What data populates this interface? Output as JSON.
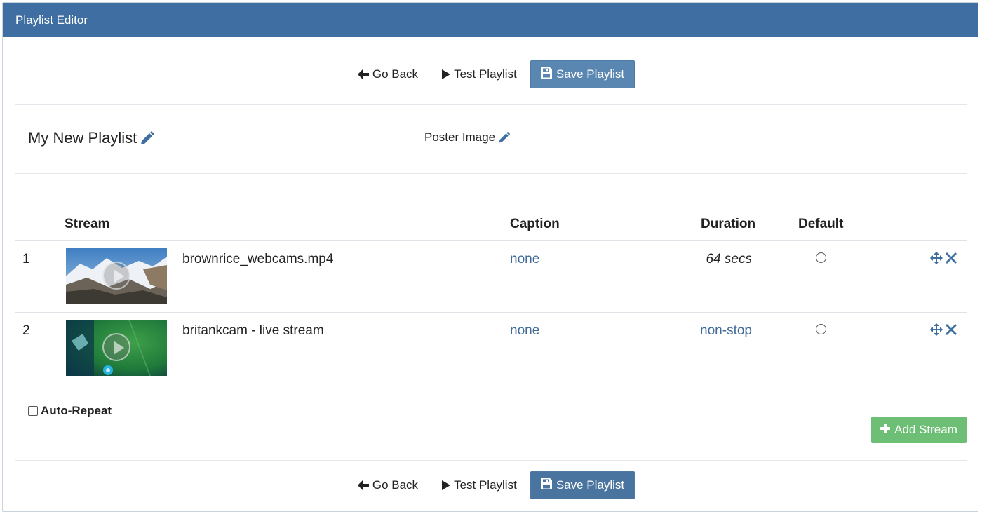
{
  "header": {
    "title": "Playlist Editor"
  },
  "toolbar": {
    "go_back": "Go Back",
    "test_playlist": "Test Playlist",
    "save_playlist": "Save Playlist"
  },
  "playlist": {
    "title": "My New Playlist",
    "poster_label": "Poster Image"
  },
  "table": {
    "headers": {
      "stream": "Stream",
      "caption": "Caption",
      "duration": "Duration",
      "default": "Default"
    },
    "rows": [
      {
        "index": "1",
        "name": "brownrice_webcams.mp4",
        "caption": "none",
        "duration": "64 secs",
        "thumbnail": "mountain-snow-thumbnail",
        "default_selected": false
      },
      {
        "index": "2",
        "name": "britankcam - live stream",
        "caption": "none",
        "duration": "non-stop",
        "thumbnail": "underwater-green-thumbnail",
        "default_selected": false
      }
    ]
  },
  "options": {
    "auto_repeat_label": "Auto-Repeat",
    "auto_repeat_checked": false
  },
  "actions": {
    "add_stream": "Add Stream"
  },
  "icons": {
    "back": "arrow-left-icon",
    "play": "play-icon",
    "save": "floppy-disk-icon",
    "edit": "pencil-icon",
    "move": "move-arrows-icon",
    "remove": "close-x-icon",
    "add": "plus-icon"
  },
  "colors": {
    "header_bg": "#3f6fa2",
    "save_button": "#5a87b2",
    "link": "#3f6a97",
    "add_button": "#6cbf74"
  }
}
